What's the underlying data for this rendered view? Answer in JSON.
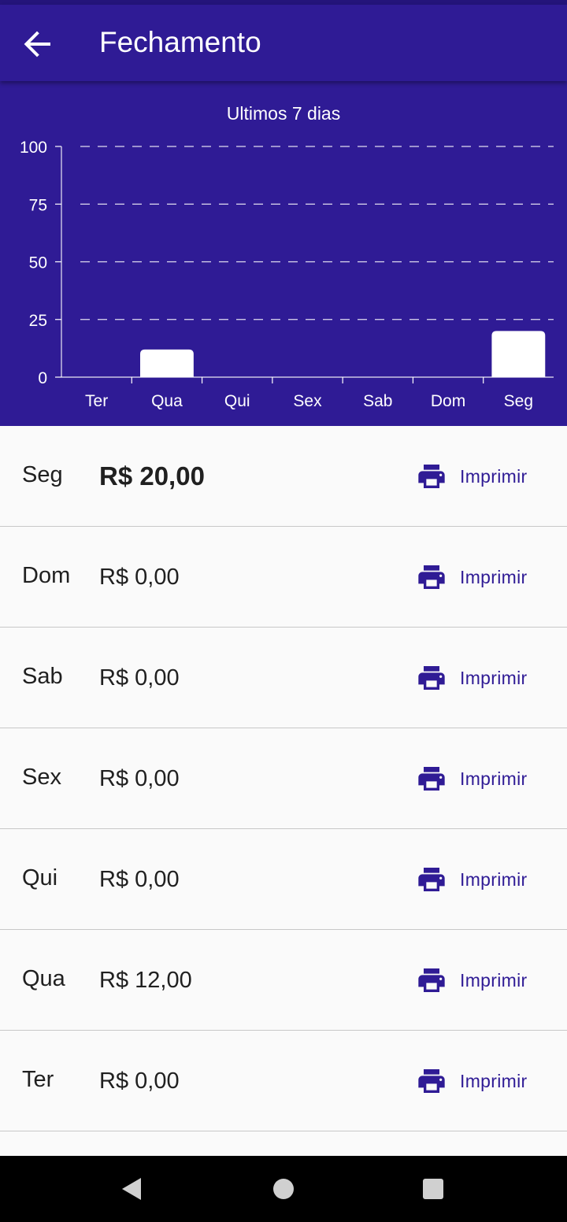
{
  "app_bar": {
    "title": "Fechamento",
    "back_icon": "arrow-back-icon"
  },
  "colors": {
    "primary": "#2f1b95",
    "bar": "#ffffff",
    "background": "#fafafa"
  },
  "chart_data": {
    "type": "bar",
    "title": "Ultimos 7 dias",
    "categories": [
      "Ter",
      "Qua",
      "Qui",
      "Sex",
      "Sab",
      "Dom",
      "Seg"
    ],
    "values": [
      0,
      12,
      0,
      0,
      0,
      0,
      20
    ],
    "ylim": [
      0,
      100
    ],
    "yticks": [
      0,
      25,
      50,
      75,
      100
    ],
    "xlabel": "",
    "ylabel": "",
    "grid": "horizontal-dashed"
  },
  "rows": [
    {
      "day": "Seg",
      "amount": "R$ 20,00",
      "print_label": "Imprimir",
      "highlight": true
    },
    {
      "day": "Dom",
      "amount": "R$ 0,00",
      "print_label": "Imprimir"
    },
    {
      "day": "Sab",
      "amount": "R$ 0,00",
      "print_label": "Imprimir"
    },
    {
      "day": "Sex",
      "amount": "R$ 0,00",
      "print_label": "Imprimir"
    },
    {
      "day": "Qui",
      "amount": "R$ 0,00",
      "print_label": "Imprimir"
    },
    {
      "day": "Qua",
      "amount": "R$ 12,00",
      "print_label": "Imprimir"
    },
    {
      "day": "Ter",
      "amount": "R$ 0,00",
      "print_label": "Imprimir"
    }
  ],
  "nav_bar": {
    "back_icon": "triangle-back-icon",
    "home_icon": "circle-home-icon",
    "recents_icon": "square-recents-icon"
  }
}
